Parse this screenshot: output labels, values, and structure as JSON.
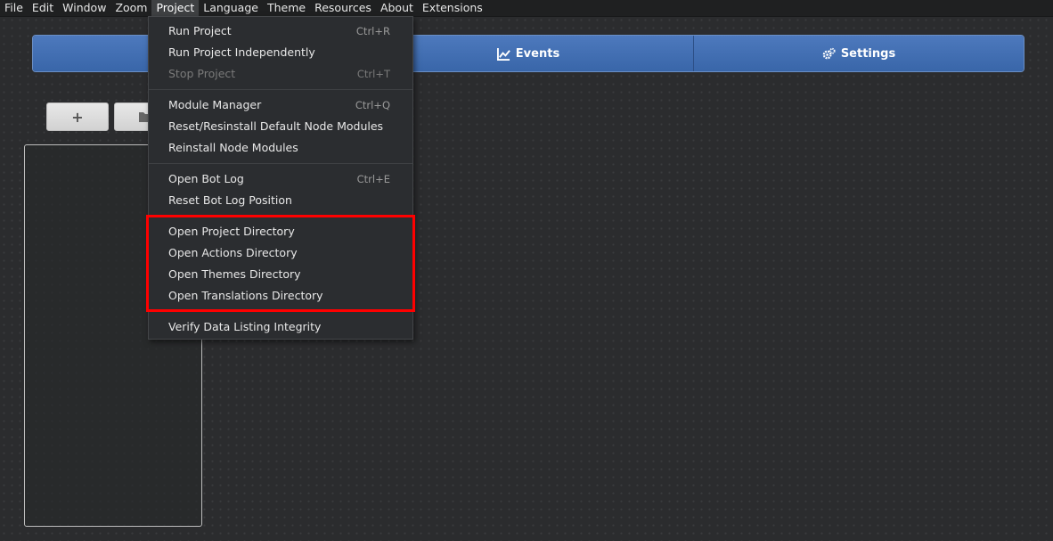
{
  "menubar": {
    "items": [
      "File",
      "Edit",
      "Window",
      "Zoom",
      "Project",
      "Language",
      "Theme",
      "Resources",
      "About",
      "Extensions"
    ],
    "active": "Project"
  },
  "tabs": [
    {
      "label": "",
      "icon": "hidden-tab-icon"
    },
    {
      "label": "Events",
      "icon": "line-chart-icon"
    },
    {
      "label": "Settings",
      "icon": "gears-icon"
    }
  ],
  "toolbar": {
    "add_label": "+",
    "folder_icon": "folder-icon"
  },
  "project_menu": {
    "run_project": {
      "label": "Run Project",
      "shortcut": "Ctrl+R"
    },
    "run_independently": {
      "label": "Run Project Independently"
    },
    "stop_project": {
      "label": "Stop Project",
      "shortcut": "Ctrl+T"
    },
    "module_manager": {
      "label": "Module Manager",
      "shortcut": "Ctrl+Q"
    },
    "reset_node_modules": {
      "label": "Reset/Resinstall Default Node Modules"
    },
    "reinstall_node_modules": {
      "label": "Reinstall Node Modules"
    },
    "open_bot_log": {
      "label": "Open Bot Log",
      "shortcut": "Ctrl+E"
    },
    "reset_bot_log": {
      "label": "Reset Bot Log Position"
    },
    "open_project_dir": {
      "label": "Open Project Directory"
    },
    "open_actions_dir": {
      "label": "Open Actions Directory"
    },
    "open_themes_dir": {
      "label": "Open Themes Directory"
    },
    "open_translations_dir": {
      "label": "Open Translations Directory"
    },
    "verify_integrity": {
      "label": "Verify Data Listing Integrity"
    }
  },
  "colors": {
    "accent": "#3f6fb5",
    "highlight": "#ff0000",
    "menu_bg": "#2b2d30"
  }
}
